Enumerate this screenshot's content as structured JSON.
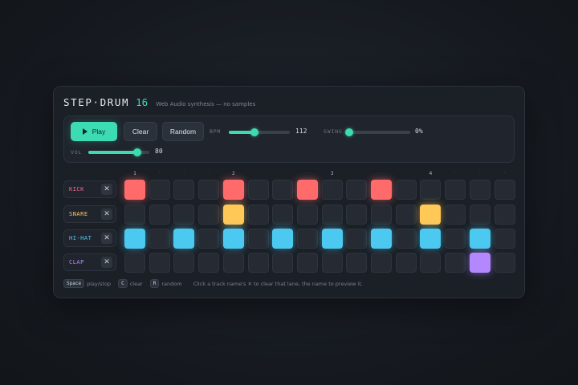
{
  "app": {
    "title": "STEP·DRUM",
    "title_num": "16",
    "subtitle": "Web Audio synthesis — no samples"
  },
  "controls": {
    "play_label": "Play",
    "clear_label": "Clear",
    "random_label": "Random",
    "bpm_label": "BPM",
    "bpm_value": "112",
    "bpm_fraction": 0.42,
    "swing_label": "SWING",
    "swing_value": "0%",
    "swing_fraction": 0.0,
    "vol_label": "VOL",
    "vol_value": "80",
    "vol_fraction": 0.8,
    "accent": "#3ddbb3"
  },
  "beats": [
    "1",
    "2",
    "3",
    "4"
  ],
  "beat_dot": "·",
  "tracks": [
    {
      "name": "KICK",
      "color": "#ff6b6b",
      "name_color": "#ff6b8f",
      "steps": [
        1,
        0,
        0,
        0,
        1,
        0,
        0,
        1,
        0,
        0,
        1,
        0,
        0,
        0,
        0,
        0
      ]
    },
    {
      "name": "SNARE",
      "color": "#ffc857",
      "name_color": "#ffc857",
      "steps": [
        0,
        0,
        0,
        0,
        1,
        0,
        0,
        0,
        0,
        0,
        0,
        0,
        1,
        0,
        0,
        0
      ]
    },
    {
      "name": "HI-HAT",
      "color": "#4cc9f0",
      "name_color": "#4cc9f0",
      "steps": [
        1,
        0,
        1,
        0,
        1,
        0,
        1,
        0,
        1,
        0,
        1,
        0,
        1,
        0,
        1,
        0
      ]
    },
    {
      "name": "CLAP",
      "color": "#b388ff",
      "name_color": "#b388ff",
      "steps": [
        0,
        0,
        0,
        0,
        0,
        0,
        0,
        0,
        0,
        0,
        0,
        0,
        0,
        0,
        1,
        0
      ]
    }
  ],
  "remove_symbol": "✕",
  "footer": {
    "key_space": "Space",
    "play_stop": "play/stop",
    "key_c": "C",
    "clear": "clear",
    "key_r": "R",
    "random": "random",
    "hint": "Click a track name's ✕ to clear that lane, the name to preview it."
  }
}
